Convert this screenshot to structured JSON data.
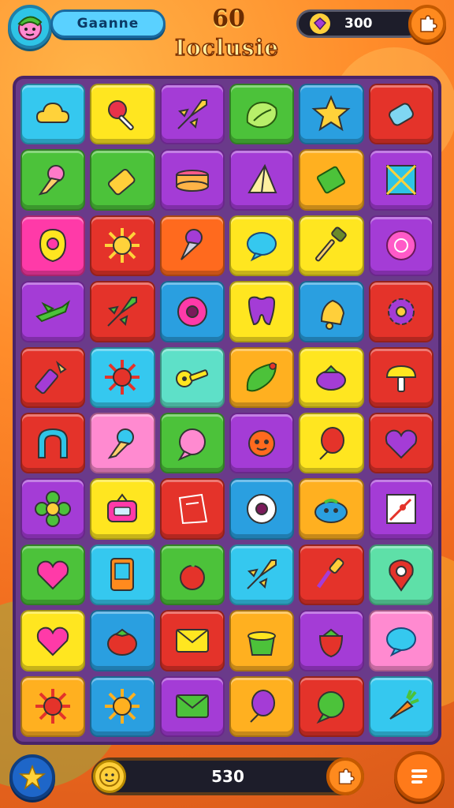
{
  "header": {
    "player_name": "Gaanne",
    "level_number": "60",
    "level_title": "Ioclusie",
    "coins": "300"
  },
  "footer": {
    "score": "530"
  },
  "icons": {
    "avatar": "character-face-icon",
    "coins": "ruby-icon",
    "settings": "puzzle-icon",
    "star": "star-icon",
    "score_badge": "coin-face-icon",
    "score_end": "puzzle-icon",
    "menu": "list-icon"
  },
  "board": {
    "rows": 10,
    "cols": 6,
    "tiles": [
      {
        "color": "#35c8ef",
        "icon": "cloud-icon",
        "fg": "#ffd23a"
      },
      {
        "color": "#ffe620",
        "icon": "lollipop-icon",
        "fg": "#e8334a"
      },
      {
        "color": "#a43cd6",
        "icon": "rocket-icon",
        "fg": "#ffd23a"
      },
      {
        "color": "#4cc23a",
        "icon": "lettuce-icon",
        "fg": "#b8ef6a"
      },
      {
        "color": "#2a9fe0",
        "icon": "star-icon",
        "fg": "#ffd23a"
      },
      {
        "color": "#e4332a",
        "icon": "candy-icon",
        "fg": "#7fd6f2"
      },
      {
        "color": "#4cc23a",
        "icon": "ice-cream-icon",
        "fg": "#ff7ac8"
      },
      {
        "color": "#4cc23a",
        "icon": "battery-icon",
        "fg": "#ffcf3a"
      },
      {
        "color": "#a43cd6",
        "icon": "cake-icon",
        "fg": "#ffb347"
      },
      {
        "color": "#a43cd6",
        "icon": "prism-icon",
        "fg": "#fff0a0"
      },
      {
        "color": "#ffb020",
        "icon": "gem-icon",
        "fg": "#4cc23a"
      },
      {
        "color": "#a43cd6",
        "icon": "window-icon",
        "fg": "#2ec4e6"
      },
      {
        "color": "#ff3aa8",
        "icon": "ring-icon",
        "fg": "#ffe620"
      },
      {
        "color": "#e4332a",
        "icon": "sun-icon",
        "fg": "#ffd23a"
      },
      {
        "color": "#ff6a1e",
        "icon": "cone-icon",
        "fg": "#a43cd6"
      },
      {
        "color": "#ffe620",
        "icon": "bubble-icon",
        "fg": "#35c8ef"
      },
      {
        "color": "#ffe620",
        "icon": "hammer-icon",
        "fg": "#6a8a2a"
      },
      {
        "color": "#a43cd6",
        "icon": "button-icon",
        "fg": "#ff5ac8"
      },
      {
        "color": "#a43cd6",
        "icon": "airplane-icon",
        "fg": "#4cc23a"
      },
      {
        "color": "#e4332a",
        "icon": "rocket-icon",
        "fg": "#4cc23a"
      },
      {
        "color": "#2a9fe0",
        "icon": "donut-icon",
        "fg": "#ff3aa8"
      },
      {
        "color": "#ffe620",
        "icon": "tooth-icon",
        "fg": "#a43cd6"
      },
      {
        "color": "#2a9fe0",
        "icon": "bell-icon",
        "fg": "#ffcf3a"
      },
      {
        "color": "#e4332a",
        "icon": "gear-icon",
        "fg": "#a43cd6"
      },
      {
        "color": "#e4332a",
        "icon": "crayon-icon",
        "fg": "#a43cd6"
      },
      {
        "color": "#35c8ef",
        "icon": "sun-icon",
        "fg": "#e4332a"
      },
      {
        "color": "#5ee0c8",
        "icon": "key-icon",
        "fg": "#ffe620"
      },
      {
        "color": "#ffb020",
        "icon": "leaf-icon",
        "fg": "#4cc23a"
      },
      {
        "color": "#ffe620",
        "icon": "eggplant-icon",
        "fg": "#a43cd6"
      },
      {
        "color": "#e4332a",
        "icon": "mushroom-icon",
        "fg": "#ffe620"
      },
      {
        "color": "#e4332a",
        "icon": "arch-icon",
        "fg": "#2ec4e6"
      },
      {
        "color": "#ff8ad0",
        "icon": "ice-cream-icon",
        "fg": "#35c8ef"
      },
      {
        "color": "#4cc23a",
        "icon": "speech-icon",
        "fg": "#ff8ad0"
      },
      {
        "color": "#a43cd6",
        "icon": "monster-icon",
        "fg": "#ff6a1e"
      },
      {
        "color": "#ffe620",
        "icon": "balloon-icon",
        "fg": "#e4332a"
      },
      {
        "color": "#e4332a",
        "icon": "heart-icon",
        "fg": "#a43cd6"
      },
      {
        "color": "#a43cd6",
        "icon": "flower-icon",
        "fg": "#4cc23a"
      },
      {
        "color": "#ffe620",
        "icon": "radio-icon",
        "fg": "#ff3aa8"
      },
      {
        "color": "#e4332a",
        "icon": "bag-icon",
        "fg": "#e4332a"
      },
      {
        "color": "#2a9fe0",
        "icon": "donut-icon",
        "fg": "#ffffff"
      },
      {
        "color": "#ffb020",
        "icon": "blob-icon",
        "fg": "#2a9fe0"
      },
      {
        "color": "#a43cd6",
        "icon": "card-icon",
        "fg": "#ffffff"
      },
      {
        "color": "#4cc23a",
        "icon": "heart-icon",
        "fg": "#ff3aa8"
      },
      {
        "color": "#35c8ef",
        "icon": "tablet-icon",
        "fg": "#ff8a1e"
      },
      {
        "color": "#4cc23a",
        "icon": "apple-icon",
        "fg": "#e4332a"
      },
      {
        "color": "#35c8ef",
        "icon": "rocket-icon",
        "fg": "#ffd23a"
      },
      {
        "color": "#e4332a",
        "icon": "brush-icon",
        "fg": "#ffcf3a"
      },
      {
        "color": "#5ee0a8",
        "icon": "pin-icon",
        "fg": "#e4332a"
      },
      {
        "color": "#ffe620",
        "icon": "heart-icon",
        "fg": "#ff3aa8"
      },
      {
        "color": "#2a9fe0",
        "icon": "tomato-icon",
        "fg": "#e4332a"
      },
      {
        "color": "#e4332a",
        "icon": "envelope-icon",
        "fg": "#ffe620"
      },
      {
        "color": "#ffb020",
        "icon": "pot-icon",
        "fg": "#4cc23a"
      },
      {
        "color": "#a43cd6",
        "icon": "strawberry-icon",
        "fg": "#e4332a"
      },
      {
        "color": "#ff8ad0",
        "icon": "bubble-icon",
        "fg": "#35c8ef"
      },
      {
        "color": "#ffb020",
        "icon": "sun-icon",
        "fg": "#e4332a"
      },
      {
        "color": "#2a9fe0",
        "icon": "sun-icon",
        "fg": "#ffb020"
      },
      {
        "color": "#a43cd6",
        "icon": "envelope-icon",
        "fg": "#4cc23a"
      },
      {
        "color": "#ffb020",
        "icon": "balloon-icon",
        "fg": "#a43cd6"
      },
      {
        "color": "#e4332a",
        "icon": "speech-icon",
        "fg": "#4cc23a"
      },
      {
        "color": "#35c8ef",
        "icon": "carrot-icon",
        "fg": "#ff8a1e"
      }
    ]
  }
}
